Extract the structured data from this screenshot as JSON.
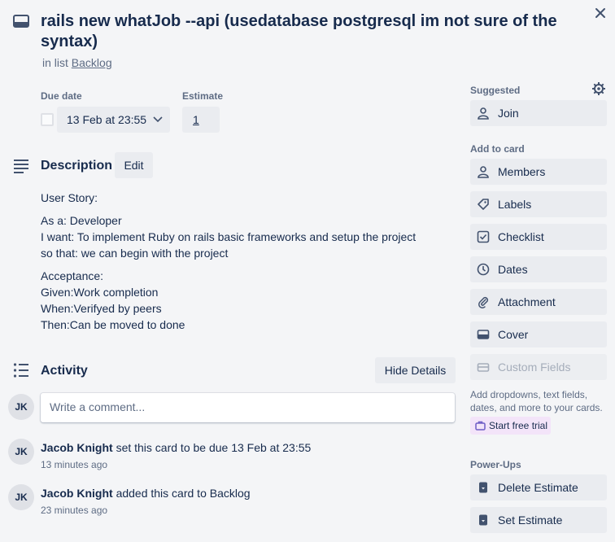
{
  "card": {
    "title": "rails new whatJob --api (usedatabase   postgresql im not sure of the syntax)",
    "list_prefix": "in list",
    "list_name": "Backlog"
  },
  "fields": {
    "due_label": "Due date",
    "due_value": "13 Feb at 23:55",
    "estimate_label": "Estimate",
    "estimate_value": "1"
  },
  "description": {
    "heading": "Description",
    "edit_label": "Edit",
    "paragraphs": [
      [
        "User Story:"
      ],
      [
        "As a: Developer",
        "I want: To implement Ruby on rails basic frameworks and setup the project",
        "so that: we can begin with the project"
      ],
      [
        "Acceptance:",
        "Given:Work completion",
        "When:Verifyed by peers",
        "Then:Can be moved to done"
      ]
    ]
  },
  "activity": {
    "heading": "Activity",
    "hide_label": "Hide Details",
    "comment_placeholder": "Write a comment...",
    "avatar_initials": "JK",
    "entries": [
      {
        "user": "Jacob Knight",
        "action": "set this card to be due 13 Feb at 23:55",
        "time": "13 minutes ago"
      },
      {
        "user": "Jacob Knight",
        "action": "added this card to Backlog",
        "time": "23 minutes ago"
      }
    ]
  },
  "sidebar": {
    "suggested_heading": "Suggested",
    "join_label": "Join",
    "add_heading": "Add to card",
    "members_label": "Members",
    "labels_label": "Labels",
    "checklist_label": "Checklist",
    "dates_label": "Dates",
    "attachment_label": "Attachment",
    "cover_label": "Cover",
    "custom_fields_label": "Custom Fields",
    "custom_fields_note": "Add dropdowns, text fields, dates, and more to your cards.",
    "trial_label": "Start free trial",
    "powerups_heading": "Power-Ups",
    "delete_estimate_label": "Delete Estimate",
    "set_estimate_label": "Set Estimate"
  },
  "colors": {
    "background": "#f4f5f7",
    "button": "#eaecf0",
    "text": "#172b4d",
    "muted": "#5e6c84",
    "trial_bg": "#f3e4f9"
  }
}
